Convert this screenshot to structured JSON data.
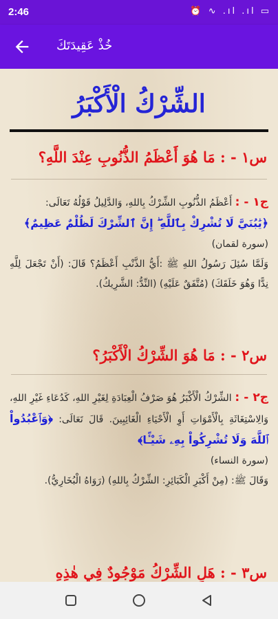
{
  "status": {
    "time": "2:46",
    "icons": "⏰ ∿ .ıl .ıl ▭"
  },
  "appbar": {
    "title": "خُذْ عَقِيدَتَكَ"
  },
  "page": {
    "title": "الشِّرْكُ الْأَكْبَرُ"
  },
  "qa": [
    {
      "question": "س١ - : مَا هُوَ أَعْظَمُ الذُّنُوبِ عِنْدَ اللَّهِ؟",
      "answer_label": "ج١ - :",
      "answer_text": "أَعْظَمُ الذُّنُوبِ الشِّرْكُ بِاللهِ، وَالدَّلِيلُ قَوْلُهُ تَعَالَى:",
      "verse": "﴿يَٰبُنَيَّ لَا تُشْرِكْ بِٱللَّهِ ۖ إِنَّ ٱلشِّرْكَ لَظُلْمٌ عَظِيمٌ﴾",
      "source": "(سورة لقمان)",
      "hadith": "وَلَمَّا سُئِلَ رَسُولُ اللهِ ﷺ :أَيُّ الذَّنْبِ أَعْظَمُ؟ قَالَ: (أَنْ تَجْعَلَ لِلَّهِ نِدًّا وَهُوَ خَلَقَكَ) (مُتَّفَقٌ عَلَيْهِ) (النِّدُّ: الشَّرِيكُ)."
    },
    {
      "question": "س٢ - : مَا هُوَ الشِّرْكُ الْأَكْبَرُ؟",
      "answer_label": "ج٢ - :",
      "answer_text": "الشِّرْكُ الْأَكْبَرُ هُوَ صَرْفُ الْعِبَادَةِ لِغَيْرِ اللهِ، كَدُعَاءِ غَيْرِ اللهِ، وَالِاسْتِغَاثَةِ بِالْأَمْوَاتِ أَوِ الْأَحْيَاءِ الْغَائِبِينَ. قَالَ تَعَالَى:",
      "verse": "﴿وَٱعْبُدُواْ ٱللَّهَ وَلَا تُشْرِكُواْ بِهِۦ شَيْـًٔا﴾",
      "source": "(سورة النساء)",
      "hadith": "وَقَالَ ﷺ: (مِنْ أَكْبَرِ الْكَبَائِرِ: الشِّرْكُ بِاللهِ) (رَوَاهُ الْبُخَارِيُّ)."
    },
    {
      "question": "س٣ - : هَلِ الشِّرْكُ مَوْجُودٌ فِي هٰذِهِ"
    }
  ]
}
